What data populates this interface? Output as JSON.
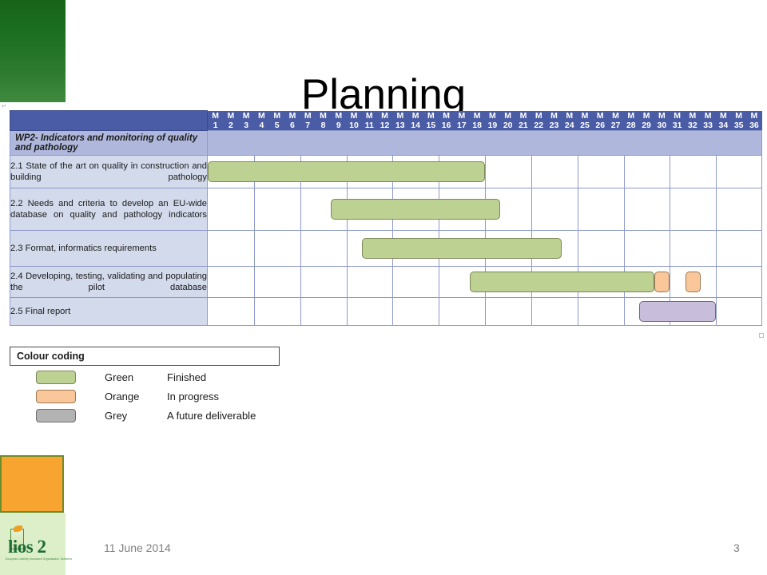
{
  "slide": {
    "title": "Planning",
    "page_number": "3",
    "date": "11 June 2014"
  },
  "logo": {
    "text": "lios 2",
    "subtitle": "European Liability Insurance Organisation Schemes"
  },
  "gantt": {
    "months_prefix": "M",
    "months": [
      1,
      2,
      3,
      4,
      5,
      6,
      7,
      8,
      9,
      10,
      11,
      12,
      13,
      14,
      15,
      16,
      17,
      18,
      19,
      20,
      21,
      22,
      23,
      24,
      25,
      26,
      27,
      28,
      29,
      30,
      31,
      32,
      33,
      34,
      35,
      36
    ],
    "workpackage": "WP2- Indicators and monitoring of quality and pathology",
    "tasks": [
      {
        "label": "2.1  State  of  the  art  on  quality  in construction and building pathology",
        "justify": true,
        "bars": [
          {
            "start": 1,
            "end": 18,
            "color": "green"
          }
        ]
      },
      {
        "label": "2.2 Needs and criteria to develop an EU-wide  database  on  quality  and  pathology indicators",
        "justify": true,
        "bars": [
          {
            "start": 9,
            "end": 19,
            "color": "green"
          }
        ]
      },
      {
        "label": "2.3 Format, informatics requirements",
        "justify": false,
        "bars": [
          {
            "start": 11,
            "end": 23,
            "color": "green"
          }
        ]
      },
      {
        "label": "2.4  Developing,  testing,  validating  and populating the pilot database",
        "justify": true,
        "bars": [
          {
            "start": 18,
            "end": 29,
            "color": "green"
          },
          {
            "start": 30,
            "end": 30,
            "color": "orange"
          },
          {
            "start": 32,
            "end": 32,
            "color": "orange"
          }
        ]
      },
      {
        "label": "2.5  Final report",
        "justify": false,
        "bars": [
          {
            "start": 29,
            "end": 33,
            "color": "purple"
          }
        ]
      }
    ]
  },
  "legend": {
    "title": "Colour coding",
    "rows": [
      {
        "swatch": "sw-green",
        "name": "Green",
        "desc": "Finished"
      },
      {
        "swatch": "sw-orange",
        "name": "Orange",
        "desc": "In progress"
      },
      {
        "swatch": "sw-grey",
        "name": "Grey",
        "desc": "A future deliverable"
      }
    ]
  },
  "colors": {
    "header_blue": "#4A5CA5",
    "wp_band": "#AFB8DC",
    "label_cell": "#D3DAEB",
    "green": "#BCD192",
    "orange": "#FAC79A",
    "purple": "#C8BEDC",
    "grey": "#B3B3B3",
    "deco_green": "#1D6F21",
    "deco_orange": "#F7A530"
  }
}
